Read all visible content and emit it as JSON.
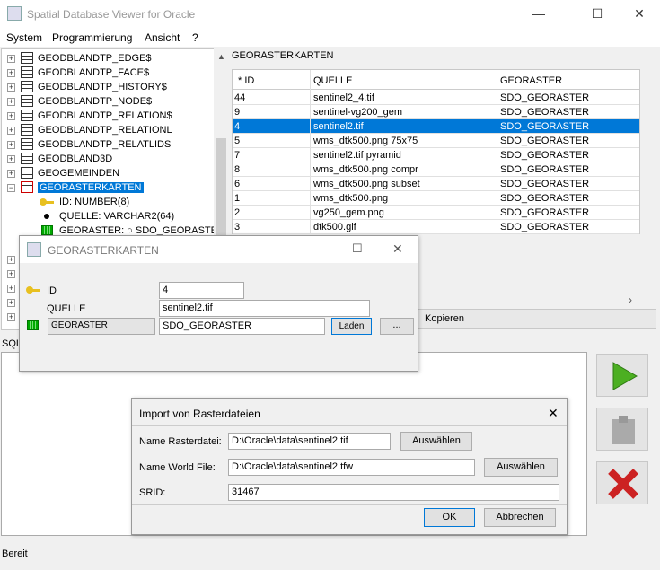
{
  "window": {
    "title": "Spatial Database Viewer for Oracle",
    "minimize": "—",
    "maximize": "☐",
    "close": "✕"
  },
  "menu": [
    "System",
    "Programmierung",
    "Ansicht",
    "?"
  ],
  "tree": {
    "items": [
      {
        "label": "GEODBLANDTP_EDGE$"
      },
      {
        "label": "GEODBLANDTP_FACE$"
      },
      {
        "label": "GEODBLANDTP_HISTORY$"
      },
      {
        "label": "GEODBLANDTP_NODE$"
      },
      {
        "label": "GEODBLANDTP_RELATION$"
      },
      {
        "label": "GEODBLANDTP_RELATIONL"
      },
      {
        "label": "GEODBLANDTP_RELATLIDS"
      },
      {
        "label": "GEODBLAND3D"
      },
      {
        "label": "GEOGEMEINDEN"
      },
      {
        "label": "GEORASTERKARTEN"
      }
    ],
    "children": [
      "ID: NUMBER(8)",
      "QUELLE: VARCHAR2(64)",
      "GEORASTER: ○ SDO_GEORASTER"
    ]
  },
  "grid": {
    "title": "GEORASTERKARTEN",
    "columns": [
      "* ID",
      "QUELLE",
      "GEORASTER"
    ],
    "rows": [
      [
        "44",
        "sentinel2_4.tif",
        "SDO_GEORASTER"
      ],
      [
        "9",
        "sentinel-vg200_gem",
        "SDO_GEORASTER"
      ],
      [
        "4",
        "sentinel2.tif",
        "SDO_GEORASTER"
      ],
      [
        "5",
        "wms_dtk500.png 75x75",
        "SDO_GEORASTER"
      ],
      [
        "7",
        "sentinel2.tif pyramid",
        "SDO_GEORASTER"
      ],
      [
        "8",
        "wms_dtk500.png compr",
        "SDO_GEORASTER"
      ],
      [
        "6",
        "wms_dtk500.png subset",
        "SDO_GEORASTER"
      ],
      [
        "1",
        "wms_dtk500.png",
        "SDO_GEORASTER"
      ],
      [
        "2",
        "vg250_gem.png",
        "SDO_GEORASTER"
      ],
      [
        "3",
        "dtk500.gif",
        "SDO_GEORASTER"
      ]
    ],
    "selected_row": 2,
    "copy_label": "Kopieren"
  },
  "sql_label": "SQL",
  "status": "Bereit",
  "editor": {
    "title": "GEORASTERKARTEN",
    "id_label": "ID",
    "id_value": "4",
    "quelle_label": "QUELLE",
    "quelle_value": "sentinel2.tif",
    "georaster_label": "GEORASTER",
    "georaster_value": "SDO_GEORASTER",
    "load_label": "Laden",
    "more_label": "..."
  },
  "import": {
    "title": "Import von Rasterdateien",
    "name_label": "Name Rasterdatei:",
    "name_value": "D:\\Oracle\\data\\sentinel2.tif",
    "select1": "Auswählen",
    "world_label": "Name World File:",
    "world_value": "D:\\Oracle\\data\\sentinel2.tfw",
    "select2": "Auswählen",
    "srid_label": "SRID:",
    "srid_value": "31467",
    "ok": "OK",
    "cancel": "Abbrechen"
  },
  "colors": {
    "selection": "#0078d7",
    "run": "#4caf22",
    "delete": "#cc2222"
  }
}
